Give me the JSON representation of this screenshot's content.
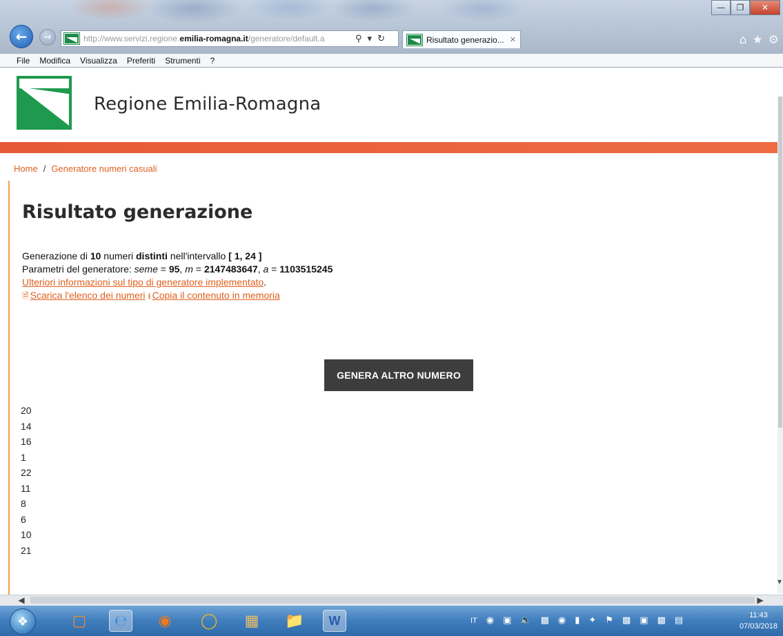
{
  "browser": {
    "url_prefix": "http://www.servizi.regione.",
    "url_domain": "emilia-romagna.it",
    "url_suffix": "/generatore/default.a",
    "tab_title": "Risultato generazio...",
    "menu": [
      "File",
      "Modifica",
      "Visualizza",
      "Preferiti",
      "Strumenti",
      "?"
    ]
  },
  "header": {
    "region_name": "Regione Emilia-Romagna"
  },
  "breadcrumb": {
    "home": "Home",
    "separator": "/",
    "current": "Generatore numeri casuali"
  },
  "main": {
    "title": "Risultato generazione",
    "gen_prefix": "Generazione di ",
    "gen_count": "10",
    "gen_mid1": " numeri ",
    "gen_distinct": "distinti",
    "gen_mid2": " nell'intervallo ",
    "gen_interval": "[ 1, 24 ]",
    "params_prefix": "Parametri del generatore: ",
    "params_seme_label": "seme",
    "params_seme_eq": " = ",
    "params_seme_value": "95",
    "params_sep1": ", ",
    "params_m_label": "m",
    "params_m_eq": " = ",
    "params_m_value": "2147483647",
    "params_sep2": ", ",
    "params_a_label": "a",
    "params_a_eq": " = ",
    "params_a_value": "1103515245",
    "info_link": "Ulteriori informazioni sul tipo di generatore implementato",
    "info_link_end": ".",
    "download_link": "Scarica l'elenco dei numeri",
    "copy_link": "Copia il contenuto in memoria",
    "generate_button": "GENERA ALTRO NUMERO",
    "numbers": [
      "20",
      "14",
      "16",
      "1",
      "22",
      "11",
      "8",
      "6",
      "10",
      "21"
    ]
  },
  "taskbar": {
    "language": "IT",
    "time": "11:43",
    "date": "07/03/2018"
  },
  "colors": {
    "accent": "#e65a36",
    "link": "#e0601f",
    "logo_green": "#1d9a4d",
    "button_bg": "#3d3d3d"
  }
}
